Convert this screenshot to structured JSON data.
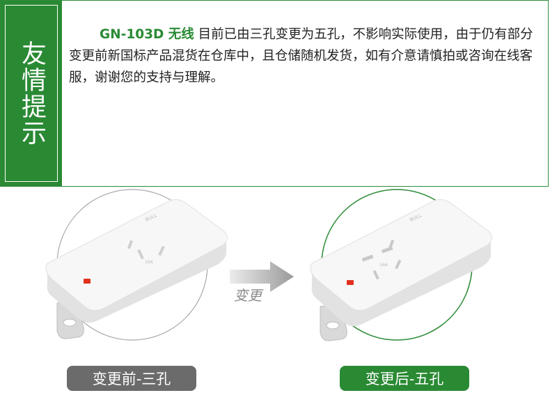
{
  "side_title": "友情提示",
  "notice": {
    "model": "GN-103D 无线",
    "text": "目前已由三孔变更为五孔，不影响实际使用，由于仍有部分变更前新国标产品混货在仓库中，且仓储随机发货，如有介意请慎拍或咨询在线客服，谢谢您的支持与理解。"
  },
  "change_label": "变更",
  "before_label": "变更前-三孔",
  "after_label": "变更后-五孔",
  "socket_rating": "16A",
  "brand_mark": "BULL",
  "colors": {
    "green": "#2a8a34",
    "gray": "#6b6b6b",
    "indicator_red": "#e0301e"
  },
  "icons": {
    "arrow": "right-arrow-icon",
    "before_circle": "gray-ring",
    "after_circle": "green-ring"
  }
}
